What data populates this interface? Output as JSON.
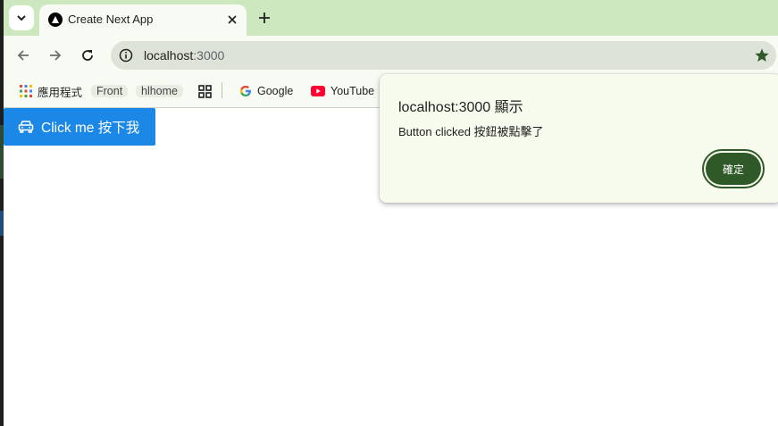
{
  "tab": {
    "title": "Create Next App"
  },
  "address_bar": {
    "host": "localhost",
    "port": ":3000"
  },
  "bookmarks": [
    {
      "label": "應用程式",
      "icon": "apps-grid-icon"
    },
    {
      "label": "Front",
      "icon": ""
    },
    {
      "label": "hlhome",
      "icon": ""
    },
    {
      "label": "",
      "icon": "tab-groups-icon"
    },
    {
      "label": "Google",
      "icon": "google-icon"
    },
    {
      "label": "YouTube",
      "icon": "youtube-icon"
    }
  ],
  "page": {
    "button_label": "Click me 按下我",
    "button_icon": "car-icon",
    "button_color": "#1b87e6"
  },
  "dialog": {
    "title": "localhost:3000 顯示",
    "message": "Button clicked 按鈕被點擊了",
    "ok_label": "確定",
    "accent": "#2f5a28"
  },
  "theme": {
    "frame": "#cde8bf",
    "toolbar": "#f8fbf4",
    "omnibox": "#dde3d8"
  }
}
